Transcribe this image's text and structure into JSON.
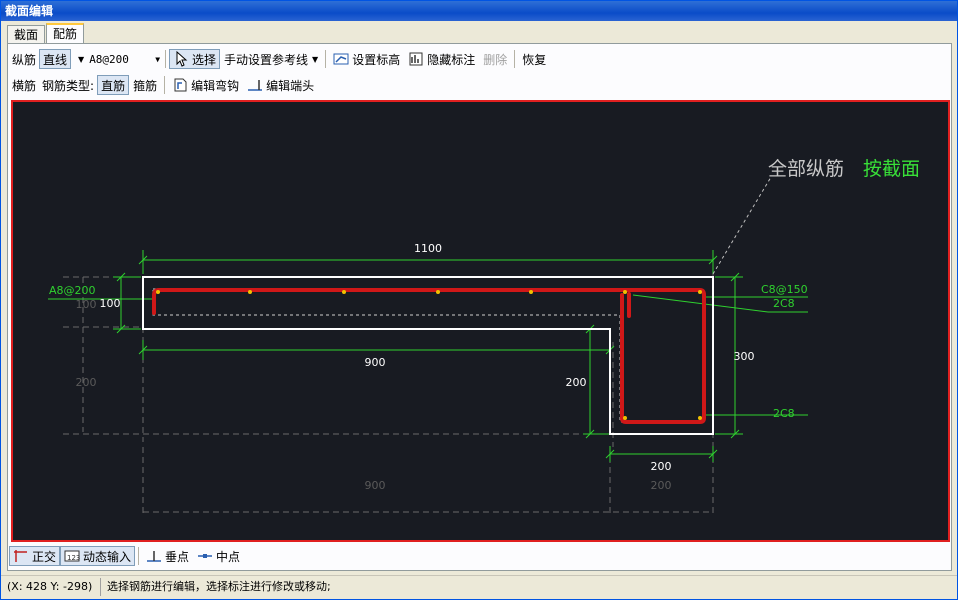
{
  "window": {
    "title": "截面编辑"
  },
  "tabs": [
    {
      "label": "截面"
    },
    {
      "label": "配筋"
    }
  ],
  "toolbar1": {
    "zongjin_label": "纵筋",
    "zhixian_label": "直线",
    "rebar_spec": "A8@200",
    "select_label": "选择",
    "manual_ref_label": "手动设置参考线",
    "set_elevation_label": "设置标高",
    "hide_annotation_label": "隐藏标注",
    "delete_label": "删除",
    "restore_label": "恢复"
  },
  "toolbar2": {
    "hengjin_label": "横筋",
    "rebar_type_label": "钢筋类型:",
    "zhijin_label": "直筋",
    "gujin_label": "箍筋",
    "edit_hook_label": "编辑弯钩",
    "edit_end_label": "编辑端头"
  },
  "canvas": {
    "callout_prefix": "全部纵筋",
    "callout_suffix": "按截面",
    "dims": {
      "top_width": "1100",
      "left_height": "100",
      "flange_length": "900",
      "web_height": "200",
      "total_height": "300",
      "web_width": "200",
      "ghost_left_height_1": "100",
      "ghost_left_height_2": "200",
      "ghost_bottom_1": "900",
      "ghost_bottom_2": "200"
    },
    "labels": {
      "left_rebar": "A8@200",
      "stirrup": "C8@150",
      "top_bars": "2C8",
      "bottom_bars": "2C8"
    }
  },
  "bottombar": {
    "ortho_label": "正交",
    "dynamic_input_label": "动态输入",
    "perpendicular_label": "垂点",
    "midpoint_label": "中点"
  },
  "status": {
    "coords": "(X: 428 Y: -298)",
    "message": "选择钢筋进行编辑，选择标注进行修改或移动;"
  },
  "colors": {
    "canvas_bg": "#181b22",
    "rebar": "#d01818",
    "outline": "#ffffff",
    "dimension": "#2fd12f",
    "callout_green": "#38e038",
    "ghost": "#5a5a5a"
  }
}
